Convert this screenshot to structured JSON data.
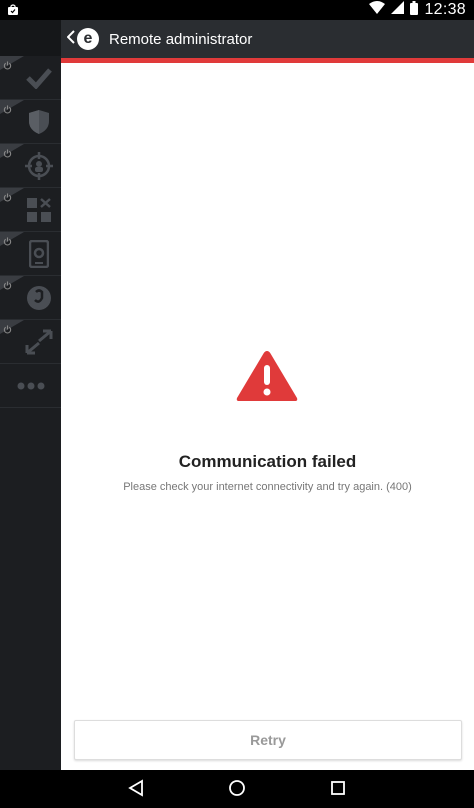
{
  "status_bar": {
    "time": "12:38"
  },
  "app_bar": {
    "title": "Remote administrator",
    "logo_letter": "e"
  },
  "sidebar": {
    "items": [
      {
        "icon": "checkmark-icon"
      },
      {
        "icon": "shield-icon"
      },
      {
        "icon": "scan-target-icon"
      },
      {
        "icon": "app-grid-icon"
      },
      {
        "icon": "device-settings-icon"
      },
      {
        "icon": "lock-badge-icon"
      },
      {
        "icon": "sync-arrows-icon"
      },
      {
        "icon": "more-dots-icon"
      }
    ]
  },
  "error": {
    "title": "Communication failed",
    "message": "Please check your internet connectivity and try again. (400)"
  },
  "actions": {
    "retry_label": "Retry"
  },
  "colors": {
    "accent_red": "#e03a3a",
    "app_bar": "#2a2d31",
    "sidebar": "#1c1e21"
  }
}
